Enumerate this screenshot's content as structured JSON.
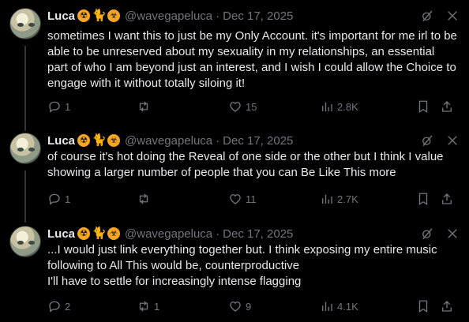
{
  "tweets": [
    {
      "name": "Luca",
      "emojis": [
        "radioactive-emoji",
        "cat-emoji",
        "biohazard-emoji"
      ],
      "handle": "@wavegapeluca",
      "date": "Dec 17, 2025",
      "text": "sometimes I want this to just be my Only Account. it's important for me irl to be able to be unreserved about my sexuality in my relationships, an essential part of who I am beyond just an interest, and I wish I could allow the Choice to engage with it without totally siloing it!",
      "replies": "1",
      "retweets": "",
      "likes": "15",
      "views": "2.8K"
    },
    {
      "name": "Luca",
      "emojis": [
        "radioactive-emoji",
        "cat-emoji",
        "biohazard-emoji"
      ],
      "handle": "@wavegapeluca",
      "date": "Dec 17, 2025",
      "text": "of course it's hot doing the Reveal of one side or the other but I think I value showing a larger number of people that you can Be Like This more",
      "replies": "1",
      "retweets": "",
      "likes": "11",
      "views": "2.7K"
    },
    {
      "name": "Luca",
      "emojis": [
        "radioactive-emoji",
        "cat-emoji",
        "biohazard-emoji"
      ],
      "handle": "@wavegapeluca",
      "date": "Dec 17, 2025",
      "text": "...I would just link everything together but. I think exposing my entire music following to All This would be, counterproductive\nI'll have to settle for increasingly intense flagging",
      "replies": "2",
      "retweets": "1",
      "likes": "9",
      "views": "4.1K"
    }
  ],
  "dot": "·",
  "colors": {
    "background": "#000000",
    "text": "#e7e9ea",
    "muted": "#71767b",
    "thread_line": "#333639"
  }
}
